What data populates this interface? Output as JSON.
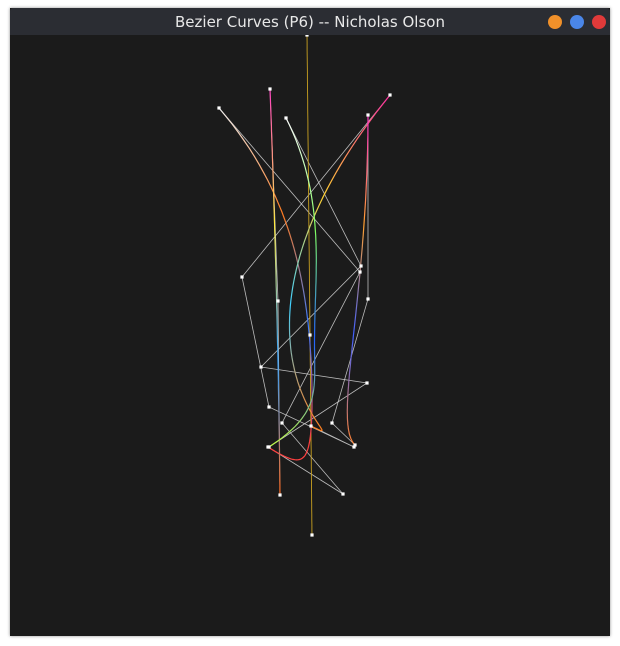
{
  "window": {
    "title": "Bezier Curves (P6) -- Nicholas Olson",
    "background": "#1b1b1b",
    "titlebar_color": "#2b2d33",
    "buttons": [
      {
        "name": "minimize-button",
        "icon": "minimize-dot-icon",
        "color": "#f0902a"
      },
      {
        "name": "maximize-button",
        "icon": "maximize-dot-icon",
        "color": "#4a86e8"
      },
      {
        "name": "close-button",
        "icon": "close-dot-icon",
        "color": "#e03a3a"
      }
    ]
  },
  "scene": {
    "control_polygon_color": "#d8d8d8",
    "control_point_color": "#ffffff",
    "curves": [
      {
        "name": "curve-1",
        "points": [
          [
            0.5,
            0.0
          ],
          [
            0.5,
            0.55
          ],
          [
            0.5,
            1.0
          ]
        ],
        "gradient": [
          "#c8a020",
          "#c8a020"
        ]
      },
      {
        "name": "curve-2",
        "points": [
          [
            0.16,
            0.14
          ],
          [
            0.62,
            0.62
          ],
          [
            0.28,
            0.86
          ]
        ],
        "gradient": [
          "#f0f0f0",
          "#ff7a20",
          "#3a7aff",
          "#ff4040"
        ]
      },
      {
        "name": "curve-3",
        "points": [
          [
            0.6,
            0.12
          ],
          [
            0.15,
            0.55
          ],
          [
            0.36,
            0.84
          ]
        ],
        "gradient": [
          "#ff2aa0",
          "#ffd030",
          "#40d0ff",
          "#ff8020"
        ]
      },
      {
        "name": "curve-4",
        "points": [
          [
            0.42,
            0.1
          ],
          [
            0.3,
            0.6
          ],
          [
            0.6,
            0.8
          ]
        ],
        "gradient": [
          "#ff40c0",
          "#ffea40",
          "#30a0ff",
          "#ff6a20"
        ]
      },
      {
        "name": "curve-5",
        "points": [
          [
            0.7,
            0.08
          ],
          [
            0.4,
            0.62
          ],
          [
            0.52,
            0.92
          ]
        ],
        "gradient": [
          "#ff30c8",
          "#ffa030",
          "#4060ff",
          "#ff8030"
        ]
      },
      {
        "name": "curve-6",
        "points": [
          [
            0.3,
            0.26
          ],
          [
            0.52,
            0.44
          ],
          [
            0.2,
            0.96
          ]
        ],
        "gradient": [
          "#ffffff",
          "#80ff60",
          "#2060ff",
          "#c0ff40"
        ]
      }
    ]
  }
}
